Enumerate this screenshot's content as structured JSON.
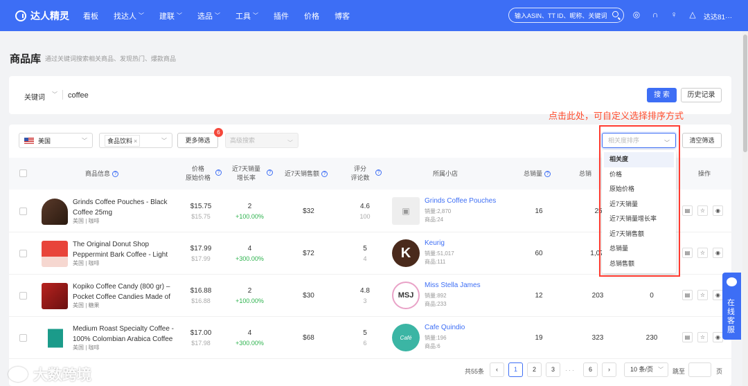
{
  "nav": {
    "logo": "达人精灵",
    "menu": [
      "看板",
      "找达人",
      "建联",
      "选品",
      "工具",
      "插件",
      "价格",
      "博客"
    ],
    "search_placeholder": "输入ASIN、TT ID、昵称、关键词",
    "user": "达达81···",
    "brand_color": "#3d6ef5"
  },
  "page": {
    "title": "商品库",
    "subtitle": "通过关键词搜索相关商品、发现热门、爆款商品"
  },
  "search": {
    "keyword_label": "关键词",
    "keyword_value": "coffee",
    "search_button": "搜 索",
    "history_button": "历史记录"
  },
  "annotation": "点击此处，可自定义选择排序方式",
  "filters": {
    "country": "美国",
    "category_tag": "食品饮料",
    "more_filters": "更多筛选",
    "more_filters_badge": "6",
    "advanced_placeholder": "高级搜索",
    "sort_placeholder": "相关度排序",
    "clear": "清空筛选"
  },
  "sort_options": [
    "相关度",
    "价格",
    "原始价格",
    "近7天销量",
    "近7天销量增长率",
    "近7天销售额",
    "总销量",
    "总销售额"
  ],
  "table": {
    "headers": {
      "product": "商品信息",
      "price": "价格",
      "orig_price": "原始价格",
      "sales7": "近7天销量",
      "growth": "增长率",
      "revenue7": "近7天销售额",
      "rating": "评分",
      "reviews": "评论数",
      "store": "所属小店",
      "total_sales": "总销量",
      "total_revenue": "总销",
      "actions": "操作"
    },
    "rows": [
      {
        "name": "Grinds Coffee Pouches - Black Coffee 25mg",
        "category": "美国 | 咖啡",
        "price": "$15.75",
        "orig_price": "$15.75",
        "sales7": "2",
        "growth": "+100.00%",
        "revenue7": "$32",
        "rating": "4.6",
        "reviews": "100",
        "store_name": "Grinds Coffee Pouches",
        "store_sales": "销量:2,870",
        "store_products": "商品:24",
        "total_sales": "16",
        "total_revenue": "25",
        "extra": ""
      },
      {
        "name": "The Original Donut Shop Peppermint Bark Coffee - Light Roast",
        "category": "美国 | 咖啡",
        "price": "$17.99",
        "orig_price": "$17.99",
        "sales7": "4",
        "growth": "+300.00%",
        "revenue7": "$72",
        "rating": "5",
        "reviews": "4",
        "store_name": "Keurig",
        "store_sales": "销量:51,017",
        "store_products": "商品:111",
        "total_sales": "60",
        "total_revenue": "1,07",
        "extra": ""
      },
      {
        "name": "Kopiko Coffee Candy (800 gr) – Pocket Coffee Candies Made of Coffee",
        "category": "美国 | 糖果",
        "price": "$16.88",
        "orig_price": "$16.88",
        "sales7": "2",
        "growth": "+100.00%",
        "revenue7": "$30",
        "rating": "4.8",
        "reviews": "3",
        "store_name": "Miss Stella James",
        "store_sales": "销量:892",
        "store_products": "商品:233",
        "total_sales": "12",
        "total_revenue": "203",
        "extra": "0"
      },
      {
        "name": "Medium Roast Specialty Coffee - 100% Colombian Arabica Coffee Beans",
        "category": "美国 | 咖啡",
        "price": "$17.00",
        "orig_price": "$17.98",
        "sales7": "4",
        "growth": "+300.00%",
        "revenue7": "$68",
        "rating": "5",
        "reviews": "6",
        "store_name": "Cafe Quindio",
        "store_sales": "销量:196",
        "store_products": "商品:6",
        "total_sales": "19",
        "total_revenue": "323",
        "extra": "230"
      }
    ]
  },
  "pagination": {
    "total": "共55条",
    "pages": [
      "1",
      "2",
      "3",
      "6"
    ],
    "active_page": "1",
    "dots": "···",
    "page_size": "10 条/页",
    "jump_label": "跳至",
    "page_label": "页"
  },
  "support": {
    "label": "在线客服"
  },
  "watermark": "大数跨境"
}
